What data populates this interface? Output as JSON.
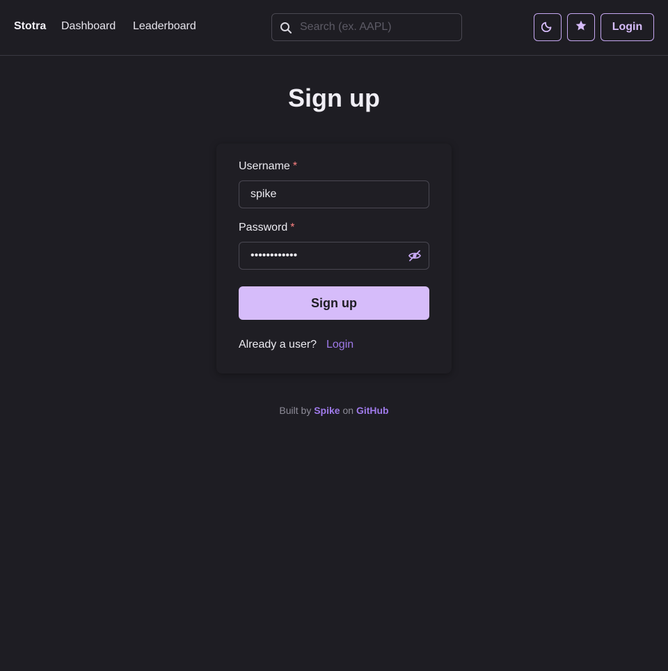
{
  "navbar": {
    "brand": "Stotra",
    "links": [
      "Dashboard",
      "Leaderboard"
    ],
    "search_placeholder": "Search (ex. AAPL)",
    "search_icon": "search-icon",
    "theme_icon": "moon-icon",
    "star_icon": "star-icon",
    "login_label": "Login"
  },
  "page": {
    "title": "Sign up"
  },
  "form": {
    "username_label": "Username",
    "username_value": "spike",
    "password_label": "Password",
    "password_value": "••••••••••••",
    "required_mark": "*",
    "visibility_icon": "eye-off-icon",
    "submit_label": "Sign up",
    "already_text": "Already a user?",
    "login_link": "Login"
  },
  "footer": {
    "built_by": "Built by",
    "author": "Spike",
    "on": "on",
    "platform": "GitHub"
  },
  "colors": {
    "background": "#1e1d23",
    "accent": "#d6bcfa",
    "link": "#9f7aea",
    "required": "#fc8181"
  }
}
